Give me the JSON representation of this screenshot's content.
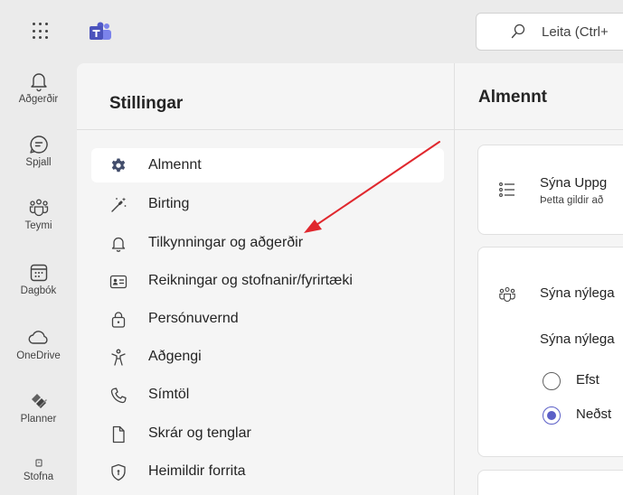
{
  "search": {
    "placeholder": "Leita (Ctrl+"
  },
  "rail": {
    "items": [
      {
        "label": "Aðgerðir",
        "icon": "bell-icon"
      },
      {
        "label": "Spjall",
        "icon": "chat-icon"
      },
      {
        "label": "Teymi",
        "icon": "teams-icon"
      },
      {
        "label": "Dagbók",
        "icon": "calendar-icon"
      },
      {
        "label": "OneDrive",
        "icon": "cloud-icon"
      },
      {
        "label": "Planner",
        "icon": "planner-icon"
      },
      {
        "label": "Stofna",
        "icon": "create-icon"
      }
    ]
  },
  "settings": {
    "title": "Stillingar",
    "items": [
      {
        "label": "Almennt",
        "icon": "gear-icon",
        "active": true
      },
      {
        "label": "Birting",
        "icon": "magic-wand-icon"
      },
      {
        "label": "Tilkynningar og aðgerðir",
        "icon": "bell-icon"
      },
      {
        "label": "Reikningar og stofnanir/fyrirtæki",
        "icon": "id-card-icon"
      },
      {
        "label": "Persónuvernd",
        "icon": "lock-icon"
      },
      {
        "label": "Aðgengi",
        "icon": "accessibility-icon"
      },
      {
        "label": "Símtöl",
        "icon": "phone-icon"
      },
      {
        "label": "Skrár og tenglar",
        "icon": "file-icon"
      },
      {
        "label": "Heimildir forrita",
        "icon": "shield-icon"
      }
    ]
  },
  "main": {
    "title": "Almennt",
    "card1": {
      "title": "Sýna Uppg",
      "subtitle": "Þetta gildir að"
    },
    "card2": {
      "title": "Sýna nýlega",
      "subtitle": "Sýna nýlega",
      "options": [
        {
          "label": "Efst",
          "selected": false
        },
        {
          "label": "Neðst",
          "selected": true
        }
      ]
    }
  },
  "colors": {
    "accent": "#5b5fc7",
    "annotation_arrow": "#e0282e",
    "teams_brand": "#4b53bc"
  }
}
